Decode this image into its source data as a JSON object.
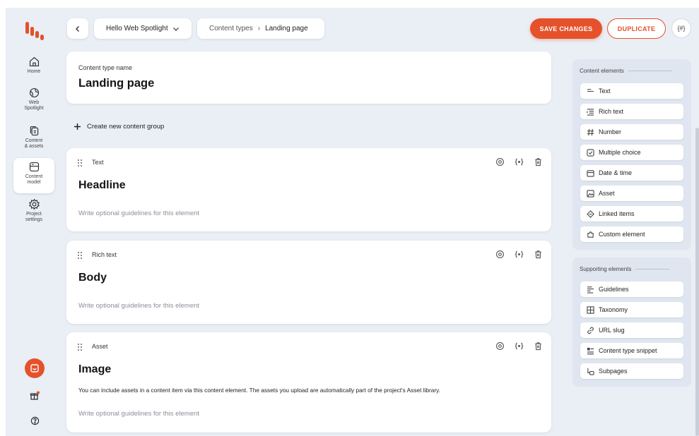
{
  "colors": {
    "accent": "#e4512b",
    "background": "#eaeef5",
    "card": "#ffffff",
    "panel": "#dfe6f0"
  },
  "nav": {
    "items": [
      {
        "label": "Home",
        "icon": "home-icon"
      },
      {
        "label": "Web\nSpotlight",
        "icon": "globe-icon"
      },
      {
        "label": "Content\n& assets",
        "icon": "content-icon"
      },
      {
        "label": "Content\nmodel",
        "icon": "content-model-icon",
        "active": true
      },
      {
        "label": "Project\nsettings",
        "icon": "gear-icon"
      }
    ]
  },
  "header": {
    "project_name": "Hello Web Spotlight",
    "breadcrumb": {
      "parent": "Content types",
      "separator": "›",
      "current": "Landing page"
    },
    "save_label": "SAVE CHANGES",
    "duplicate_label": "DUPLICATE",
    "code_label": "{#}"
  },
  "name_card": {
    "label": "Content type name",
    "value": "Landing page"
  },
  "create_group": {
    "icon": "plus-icon",
    "label": "Create new content group"
  },
  "elements": [
    {
      "type": "Text",
      "name": "Headline",
      "description": "",
      "hint": "Write optional guidelines for this element"
    },
    {
      "type": "Rich text",
      "name": "Body",
      "description": "",
      "hint": "Write optional guidelines for this element"
    },
    {
      "type": "Asset",
      "name": "Image",
      "description": "You can include assets in a content item via this content element. The assets you upload are automatically part of the project's Asset library.",
      "hint": "Write optional guidelines for this element"
    }
  ],
  "content_elements": {
    "title": "Content elements",
    "items": [
      {
        "label": "Text",
        "icon": "text-icon"
      },
      {
        "label": "Rich text",
        "icon": "rich-text-icon"
      },
      {
        "label": "Number",
        "icon": "hash-icon"
      },
      {
        "label": "Multiple choice",
        "icon": "checkbox-icon"
      },
      {
        "label": "Date & time",
        "icon": "calendar-icon"
      },
      {
        "label": "Asset",
        "icon": "image-icon"
      },
      {
        "label": "Linked items",
        "icon": "linked-items-icon"
      },
      {
        "label": "Custom element",
        "icon": "puzzle-icon"
      }
    ]
  },
  "supporting_elements": {
    "title": "Supporting elements",
    "items": [
      {
        "label": "Guidelines",
        "icon": "guidelines-icon"
      },
      {
        "label": "Taxonomy",
        "icon": "taxonomy-icon"
      },
      {
        "label": "URL slug",
        "icon": "link-icon"
      },
      {
        "label": "Content type snippet",
        "icon": "snippet-icon"
      },
      {
        "label": "Subpages",
        "icon": "subpages-icon"
      }
    ]
  }
}
